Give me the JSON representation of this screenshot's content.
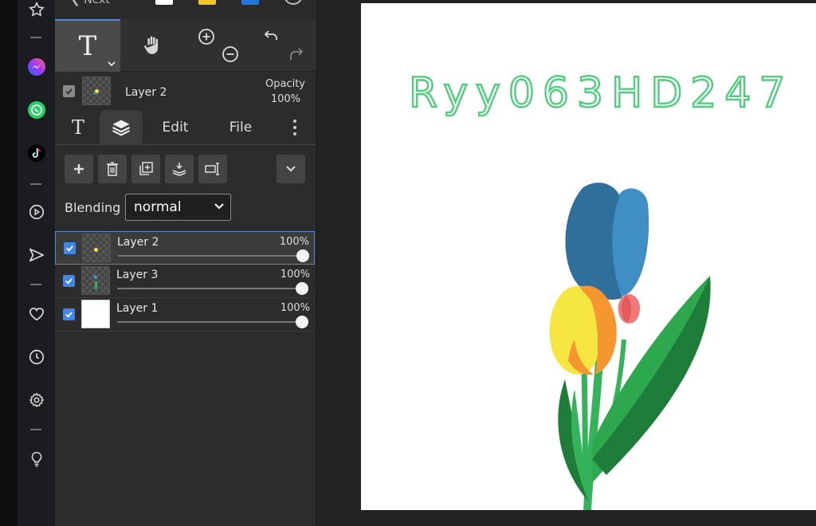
{
  "top_strip": {
    "back_label": "Next"
  },
  "layer_panel": {
    "current_layer_name": "Layer 2",
    "opacity_label": "Opacity",
    "opacity_value": "100%"
  },
  "tabs": {
    "edit": "Edit",
    "file": "File"
  },
  "blending": {
    "label": "Blending",
    "value": "normal"
  },
  "layers": [
    {
      "name": "Layer 2",
      "opacity": "100%"
    },
    {
      "name": "Layer 3",
      "opacity": "100%"
    },
    {
      "name": "Layer 1",
      "opacity": "100%"
    }
  ],
  "canvas": {
    "text": "Ryy063HD247"
  },
  "colors": {
    "accent": "#4d8be0",
    "text_outline": "#4fcf7d",
    "tulip_blue": "#3f8fc5",
    "tulip_yellow": "#f5e642",
    "tulip_orange": "#f5962e",
    "stem_green": "#34b35a",
    "leaf_dark": "#1f7d3a",
    "bud_pink": "#f07a7a"
  },
  "icons": {
    "rail": [
      "star-icon",
      "messenger-icon",
      "whatsapp-icon",
      "tiktok-icon",
      "play-circle-icon",
      "send-icon",
      "heart-icon",
      "clock-icon",
      "gear-icon",
      "lightbulb-icon"
    ],
    "tools": [
      "text-tool-icon",
      "hand-tool-icon",
      "zoom-in-icon",
      "zoom-out-icon",
      "undo-icon",
      "redo-icon"
    ],
    "layer_actions": [
      "add-layer-icon",
      "delete-layer-icon",
      "duplicate-layer-icon",
      "merge-down-icon",
      "resize-layer-icon",
      "chevron-down-icon"
    ]
  }
}
